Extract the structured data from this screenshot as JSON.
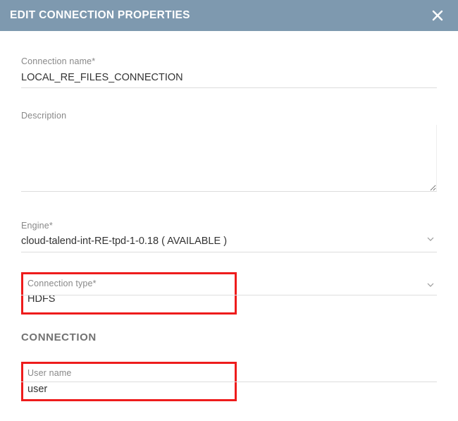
{
  "header": {
    "title": "EDIT CONNECTION PROPERTIES"
  },
  "form": {
    "connection_name": {
      "label": "Connection name*",
      "value": "LOCAL_RE_FILES_CONNECTION"
    },
    "description": {
      "label": "Description",
      "value": ""
    },
    "engine": {
      "label": "Engine*",
      "value": "cloud-talend-int-RE-tpd-1-0.18 ( AVAILABLE )"
    },
    "connection_type": {
      "label": "Connection type*",
      "value": "HDFS"
    },
    "section_heading": "CONNECTION",
    "user_name": {
      "label": "User name",
      "value": "user"
    }
  }
}
